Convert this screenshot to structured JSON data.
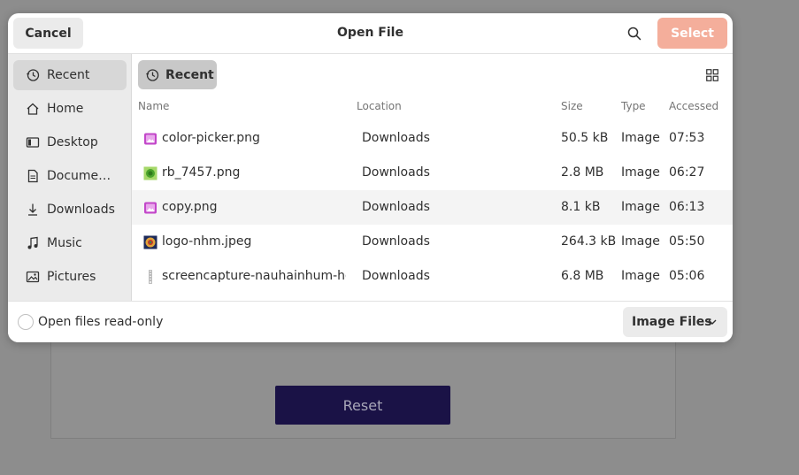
{
  "background": {
    "reset_label": "Reset"
  },
  "dialog": {
    "title": "Open File",
    "cancel_label": "Cancel",
    "select_label": "Select",
    "path_label": "Recent",
    "sidebar": [
      {
        "label": "Recent",
        "icon": "history-icon"
      },
      {
        "label": "Home",
        "icon": "home-icon"
      },
      {
        "label": "Desktop",
        "icon": "desktop-icon"
      },
      {
        "label": "Docume…",
        "icon": "document-icon"
      },
      {
        "label": "Downloads",
        "icon": "download-icon"
      },
      {
        "label": "Music",
        "icon": "music-icon"
      },
      {
        "label": "Pictures",
        "icon": "pictures-icon"
      }
    ],
    "columns": {
      "name": "Name",
      "location": "Location",
      "size": "Size",
      "type": "Type",
      "accessed": "Accessed"
    },
    "files": [
      {
        "name": "color-picker.png",
        "location": "Downloads",
        "size": "50.5 kB",
        "type": "Image",
        "accessed": "07:53",
        "icon": "image-file-icon"
      },
      {
        "name": "rb_7457.png",
        "location": "Downloads",
        "size": "2.8 MB",
        "type": "Image",
        "accessed": "06:27",
        "icon": "green-thumbnail-icon"
      },
      {
        "name": "copy.png",
        "location": "Downloads",
        "size": "8.1 kB",
        "type": "Image",
        "accessed": "06:13",
        "icon": "image-file-icon"
      },
      {
        "name": "logo-nhm.jpeg",
        "location": "Downloads",
        "size": "264.3 kB",
        "type": "Image",
        "accessed": "05:50",
        "icon": "logo-thumbnail-icon"
      },
      {
        "name": "screencapture-nauhainhum-hor",
        "location": "Downloads",
        "size": "6.8 MB",
        "type": "Image",
        "accessed": "05:06",
        "icon": "screenshot-thumbnail-icon"
      }
    ],
    "footer": {
      "readonly_label": "Open files read-only",
      "filter_label": "Image Files"
    },
    "colors": {
      "select_button": "#f4ae9b",
      "reset_button": "#1a1246",
      "image_icon": "#c247c9"
    }
  }
}
